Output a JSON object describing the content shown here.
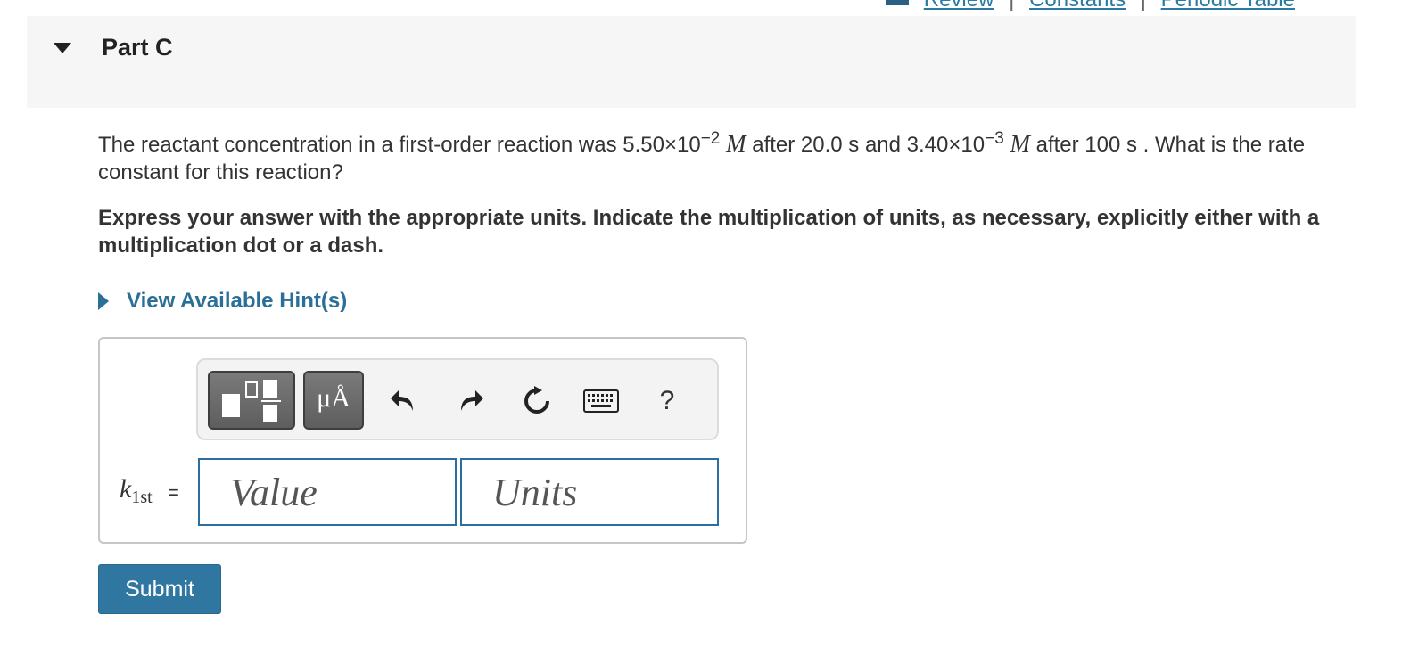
{
  "top_links": {
    "review": "Review",
    "constants": "Constants",
    "periodic_table": "Periodic Table",
    "separator": "|"
  },
  "part": {
    "title": "Part C"
  },
  "question": {
    "text_1": "The reactant concentration in a first-order reaction was 5.50×10",
    "exp_1": "−2",
    "unit_1": "M",
    "text_2": " after 20.0 s and 3.40×10",
    "exp_2": "−3",
    "unit_2": "M",
    "text_3": " after 100 s . What is the rate constant for this reaction?"
  },
  "instruction": "Express your answer with the appropriate units. Indicate the multiplication of units, as necessary, explicitly either with a multiplication dot or a dash.",
  "hint": {
    "label": "View Available Hint(s)"
  },
  "answer": {
    "variable": "k",
    "variable_subscript": "1st",
    "equals": "=",
    "value_placeholder": "Value",
    "units_placeholder": "Units"
  },
  "toolbar": {
    "units_glyph": "μÅ",
    "help_label": "?"
  },
  "submit_label": "Submit"
}
